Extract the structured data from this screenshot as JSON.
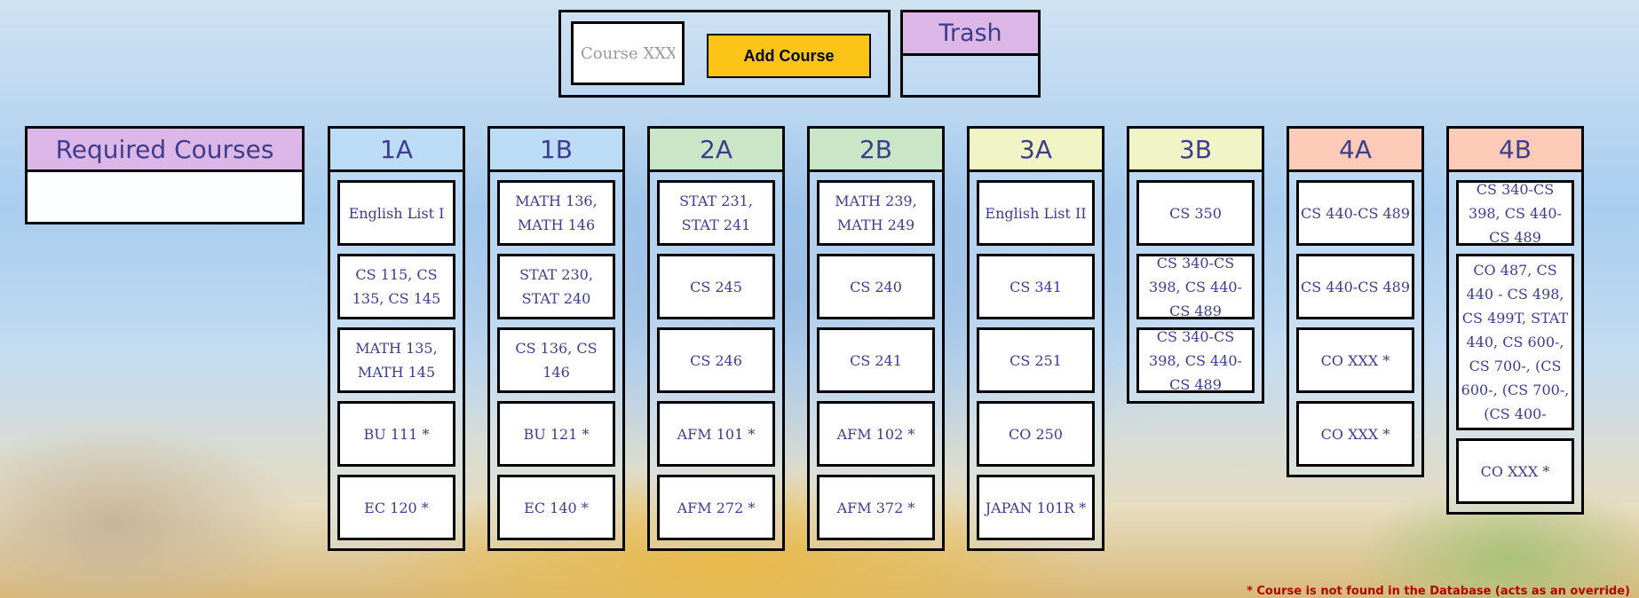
{
  "controls": {
    "input_placeholder": "Course XXX",
    "add_label": "Add Course",
    "trash_label": "Trash"
  },
  "required": {
    "title": "Required Courses"
  },
  "colors": {
    "header_purple": "#dcb6e6",
    "header_blue": "#bcdcf6",
    "header_green": "#c9e6c6",
    "header_yellow": "#f1f4c4",
    "header_peach": "#fdcbb8",
    "button_yellow": "#fcc419",
    "text_indigo": "#3d3d8c",
    "note_red": "#b40000"
  },
  "terms": [
    {
      "label": "1A",
      "courses": [
        "English List I",
        "CS 115, CS 135, CS 145",
        "MATH 135, MATH 145",
        "BU 111 *",
        "EC 120 *"
      ]
    },
    {
      "label": "1B",
      "courses": [
        "MATH 136, MATH 146",
        "STAT 230, STAT 240",
        "CS 136, CS 146",
        "BU 121 *",
        "EC 140 *"
      ]
    },
    {
      "label": "2A",
      "courses": [
        "STAT 231, STAT 241",
        "CS 245",
        "CS 246",
        "AFM 101 *",
        "AFM 272 *"
      ]
    },
    {
      "label": "2B",
      "courses": [
        "MATH 239, MATH 249",
        "CS 240",
        "CS 241",
        "AFM 102 *",
        "AFM 372 *"
      ]
    },
    {
      "label": "3A",
      "courses": [
        "English List II",
        "CS 341",
        "CS 251",
        "CO 250",
        "JAPAN 101R *"
      ]
    },
    {
      "label": "3B",
      "courses": [
        "CS 350",
        "CS 340-CS 398, CS 440-CS 489",
        "CS 340-CS 398, CS 440-CS 489"
      ]
    },
    {
      "label": "4A",
      "courses": [
        "CS 440-CS 489",
        "CS 440-CS 489",
        "CO XXX *",
        "CO XXX *"
      ]
    },
    {
      "label": "4B",
      "courses": [
        "CS 340-CS 398, CS 440-CS 489",
        "CO 487, CS 440 - CS 498, CS 499T, STAT 440, CS 600-, CS 700-, (CS 600-, (CS 700-, (CS 400-",
        "CO XXX *"
      ]
    }
  ],
  "footnote": "* Course is not found in the Database (acts as an override)"
}
